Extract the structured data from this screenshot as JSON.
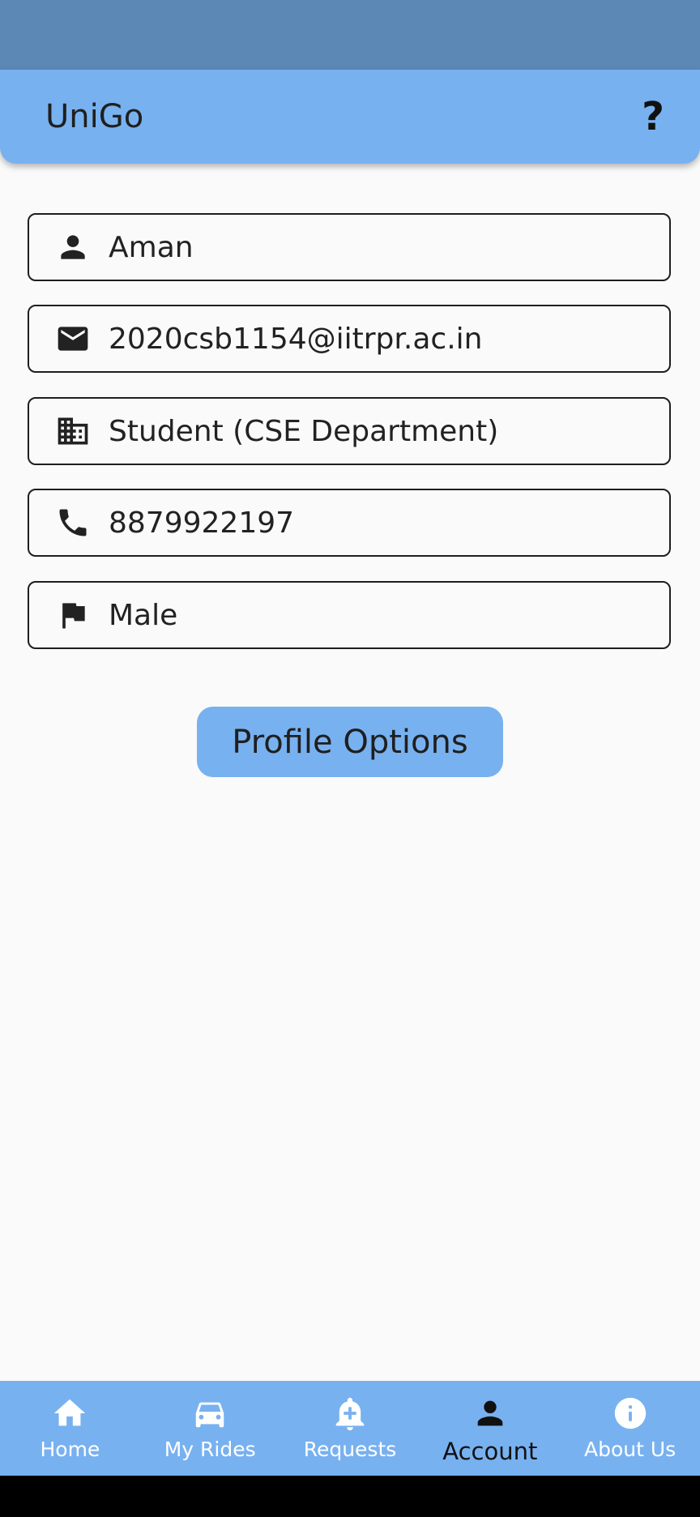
{
  "app": {
    "title": "UniGo",
    "help_label": "?"
  },
  "colors": {
    "primary": "#78b1f0",
    "status_bar": "#5b88b5",
    "background": "#fafafa"
  },
  "profile": {
    "fields": [
      {
        "icon": "person-icon",
        "value": "Aman"
      },
      {
        "icon": "email-icon",
        "value": "2020csb1154@iitrpr.ac.in"
      },
      {
        "icon": "building-icon",
        "value": "Student (CSE Department)"
      },
      {
        "icon": "phone-icon",
        "value": "8879922197"
      },
      {
        "icon": "flag-icon",
        "value": "Male"
      }
    ],
    "options_button": "Profile Options"
  },
  "bottom_nav": {
    "active": "Account",
    "items": [
      {
        "icon": "home-icon",
        "label": "Home"
      },
      {
        "icon": "car-icon",
        "label": "My Rides"
      },
      {
        "icon": "bell-plus-icon",
        "label": "Requests"
      },
      {
        "icon": "person-icon",
        "label": "Account"
      },
      {
        "icon": "info-icon",
        "label": "About Us"
      }
    ]
  }
}
